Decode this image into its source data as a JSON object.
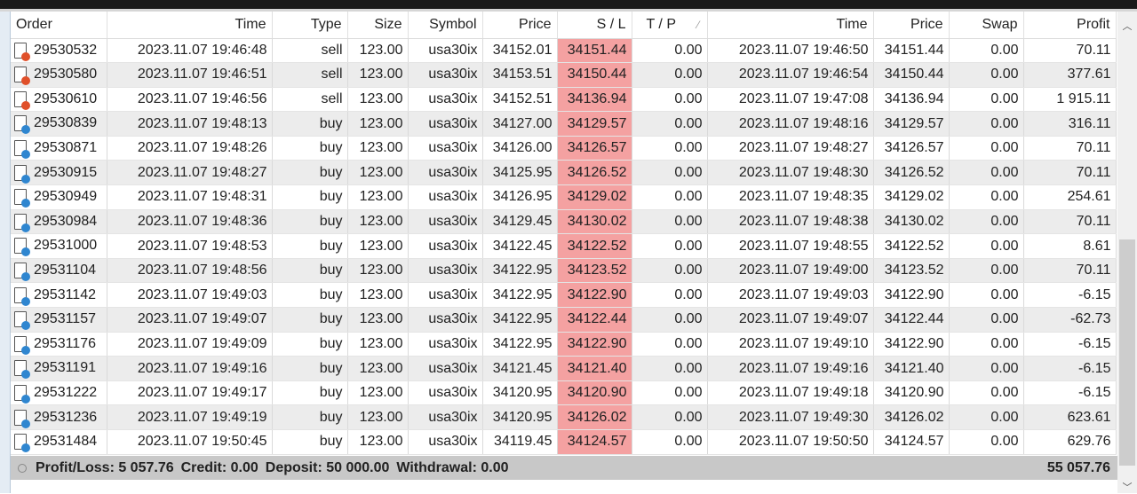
{
  "columns": [
    "Order",
    "Time",
    "Type",
    "Size",
    "Symbol",
    "Price",
    "S / L",
    "T / P",
    "Time",
    "Price",
    "Swap",
    "Profit"
  ],
  "tp_sort_glyph": "⁄",
  "colors": {
    "sell": "#e0502a",
    "buy": "#2f86d0",
    "sl_highlight": "#f4a1a1"
  },
  "rows": [
    [
      "29530532",
      "2023.11.07 19:46:48",
      "sell",
      "123.00",
      "usa30ix",
      "34152.01",
      "34151.44",
      "0.00",
      "2023.11.07 19:46:50",
      "34151.44",
      "0.00",
      "70.11"
    ],
    [
      "29530580",
      "2023.11.07 19:46:51",
      "sell",
      "123.00",
      "usa30ix",
      "34153.51",
      "34150.44",
      "0.00",
      "2023.11.07 19:46:54",
      "34150.44",
      "0.00",
      "377.61"
    ],
    [
      "29530610",
      "2023.11.07 19:46:56",
      "sell",
      "123.00",
      "usa30ix",
      "34152.51",
      "34136.94",
      "0.00",
      "2023.11.07 19:47:08",
      "34136.94",
      "0.00",
      "1 915.11"
    ],
    [
      "29530839",
      "2023.11.07 19:48:13",
      "buy",
      "123.00",
      "usa30ix",
      "34127.00",
      "34129.57",
      "0.00",
      "2023.11.07 19:48:16",
      "34129.57",
      "0.00",
      "316.11"
    ],
    [
      "29530871",
      "2023.11.07 19:48:26",
      "buy",
      "123.00",
      "usa30ix",
      "34126.00",
      "34126.57",
      "0.00",
      "2023.11.07 19:48:27",
      "34126.57",
      "0.00",
      "70.11"
    ],
    [
      "29530915",
      "2023.11.07 19:48:27",
      "buy",
      "123.00",
      "usa30ix",
      "34125.95",
      "34126.52",
      "0.00",
      "2023.11.07 19:48:30",
      "34126.52",
      "0.00",
      "70.11"
    ],
    [
      "29530949",
      "2023.11.07 19:48:31",
      "buy",
      "123.00",
      "usa30ix",
      "34126.95",
      "34129.02",
      "0.00",
      "2023.11.07 19:48:35",
      "34129.02",
      "0.00",
      "254.61"
    ],
    [
      "29530984",
      "2023.11.07 19:48:36",
      "buy",
      "123.00",
      "usa30ix",
      "34129.45",
      "34130.02",
      "0.00",
      "2023.11.07 19:48:38",
      "34130.02",
      "0.00",
      "70.11"
    ],
    [
      "29531000",
      "2023.11.07 19:48:53",
      "buy",
      "123.00",
      "usa30ix",
      "34122.45",
      "34122.52",
      "0.00",
      "2023.11.07 19:48:55",
      "34122.52",
      "0.00",
      "8.61"
    ],
    [
      "29531104",
      "2023.11.07 19:48:56",
      "buy",
      "123.00",
      "usa30ix",
      "34122.95",
      "34123.52",
      "0.00",
      "2023.11.07 19:49:00",
      "34123.52",
      "0.00",
      "70.11"
    ],
    [
      "29531142",
      "2023.11.07 19:49:03",
      "buy",
      "123.00",
      "usa30ix",
      "34122.95",
      "34122.90",
      "0.00",
      "2023.11.07 19:49:03",
      "34122.90",
      "0.00",
      "-6.15"
    ],
    [
      "29531157",
      "2023.11.07 19:49:07",
      "buy",
      "123.00",
      "usa30ix",
      "34122.95",
      "34122.44",
      "0.00",
      "2023.11.07 19:49:07",
      "34122.44",
      "0.00",
      "-62.73"
    ],
    [
      "29531176",
      "2023.11.07 19:49:09",
      "buy",
      "123.00",
      "usa30ix",
      "34122.95",
      "34122.90",
      "0.00",
      "2023.11.07 19:49:10",
      "34122.90",
      "0.00",
      "-6.15"
    ],
    [
      "29531191",
      "2023.11.07 19:49:16",
      "buy",
      "123.00",
      "usa30ix",
      "34121.45",
      "34121.40",
      "0.00",
      "2023.11.07 19:49:16",
      "34121.40",
      "0.00",
      "-6.15"
    ],
    [
      "29531222",
      "2023.11.07 19:49:17",
      "buy",
      "123.00",
      "usa30ix",
      "34120.95",
      "34120.90",
      "0.00",
      "2023.11.07 19:49:18",
      "34120.90",
      "0.00",
      "-6.15"
    ],
    [
      "29531236",
      "2023.11.07 19:49:19",
      "buy",
      "123.00",
      "usa30ix",
      "34120.95",
      "34126.02",
      "0.00",
      "2023.11.07 19:49:30",
      "34126.02",
      "0.00",
      "623.61"
    ],
    [
      "29531484",
      "2023.11.07 19:50:45",
      "buy",
      "123.00",
      "usa30ix",
      "34119.45",
      "34124.57",
      "0.00",
      "2023.11.07 19:50:50",
      "34124.57",
      "0.00",
      "629.76"
    ]
  ],
  "footer": {
    "profit_loss": "Profit/Loss: 5 057.76",
    "credit": "Credit: 0.00",
    "deposit": "Deposit: 50 000.00",
    "withdrawal": "Withdrawal: 0.00",
    "balance": "55 057.76"
  }
}
